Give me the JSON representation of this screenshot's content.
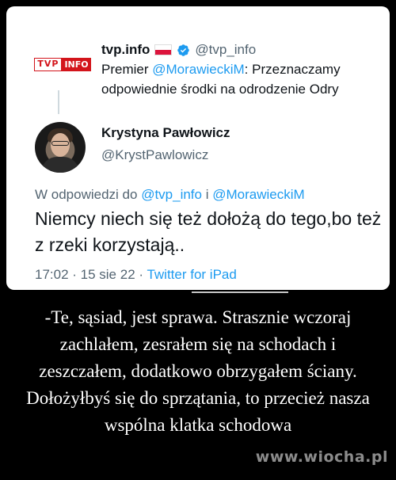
{
  "quoted_tweet": {
    "logo_left": "TVP",
    "logo_right": "INFO",
    "name": "tvp.info",
    "handle": "@tvp_info",
    "text_prefix": "Premier ",
    "mention": "@MorawieckiM",
    "text_suffix": ": Przeznaczamy odpowiednie środki na odrodzenie Odry"
  },
  "tweet": {
    "name": "Krystyna Pawłowicz",
    "handle": "@KrystPawlowicz",
    "reply_prefix": "W odpowiedzi do ",
    "reply_mention_1": "@tvp_info",
    "reply_join": " i ",
    "reply_mention_2": "@MorawieckiM",
    "text": "Niemcy niech się też dołożą do tego,bo też z rzeki korzystają..",
    "time": "17:02 · 15 sie 22 · ",
    "source": "Twitter for iPad"
  },
  "caption": "-Te, sąsiad, jest sprawa. Strasznie wczoraj zachlałem, zesrałem się na schodach i zeszczałem, dodatkowo obrzygałem ściany. Dołożyłbyś się do sprzątania, to przecież nasza wspólna klatka schodowa",
  "watermark": "www.wiocha.pl",
  "colors": {
    "link": "#1d9bf0",
    "tvp_red": "#d3141b",
    "text": "#0f1419",
    "secondary": "#536471",
    "background": "#000000"
  }
}
